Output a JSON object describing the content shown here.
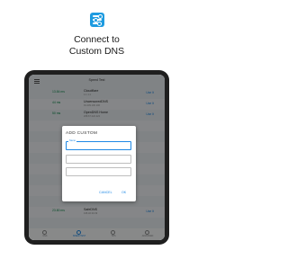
{
  "headline": {
    "line1": "Connect to",
    "line2": "Custom DNS"
  },
  "app": {
    "title": "Speed Test"
  },
  "dns_list": [
    {
      "ping": "13.84 ms",
      "name": "Cloudflare",
      "ip": "1.1.1.1",
      "action": "Use It"
    },
    {
      "ping": "44 ms",
      "name": "UncensoredDNS",
      "ip": "91.239.100.100",
      "action": "Use It"
    },
    {
      "ping": "50 ms",
      "name": "OpenDNS Home",
      "ip": "208.67.222.222",
      "action": "Use It"
    },
    {
      "ping": "",
      "name": "",
      "ip": "",
      "action": ""
    },
    {
      "ping": "",
      "name": "",
      "ip": "",
      "action": ""
    },
    {
      "ping": "",
      "name": "",
      "ip": "",
      "action": ""
    },
    {
      "ping": "",
      "name": "",
      "ip": "",
      "action": ""
    },
    {
      "ping": "",
      "name": "",
      "ip": "",
      "action": ""
    },
    {
      "ping": "",
      "name": "",
      "ip": "",
      "action": ""
    },
    {
      "ping": "",
      "name": "",
      "ip": "",
      "action": ""
    },
    {
      "ping": "",
      "name": "",
      "ip": "",
      "action": ""
    },
    {
      "ping": "23.80 ms",
      "name": "SafeDNS",
      "ip": "195.46.39.39",
      "action": "Use It"
    },
    {
      "ping": "",
      "name": "",
      "ip": "",
      "action": ""
    }
  ],
  "dialog": {
    "title": "ADD CUSTOM",
    "field_label": "Name",
    "cancel": "CANCEL",
    "ok": "OK"
  },
  "nav": [
    {
      "label": "DNS"
    },
    {
      "label": "SPEED TEST"
    },
    {
      "label": "TIPS"
    },
    {
      "label": "ADVANCED"
    }
  ],
  "colors": {
    "accent": "#1e88e5",
    "ping_good": "#0a8a4a",
    "ping_mid": "#e07c00",
    "logo": "#1e9be0"
  }
}
